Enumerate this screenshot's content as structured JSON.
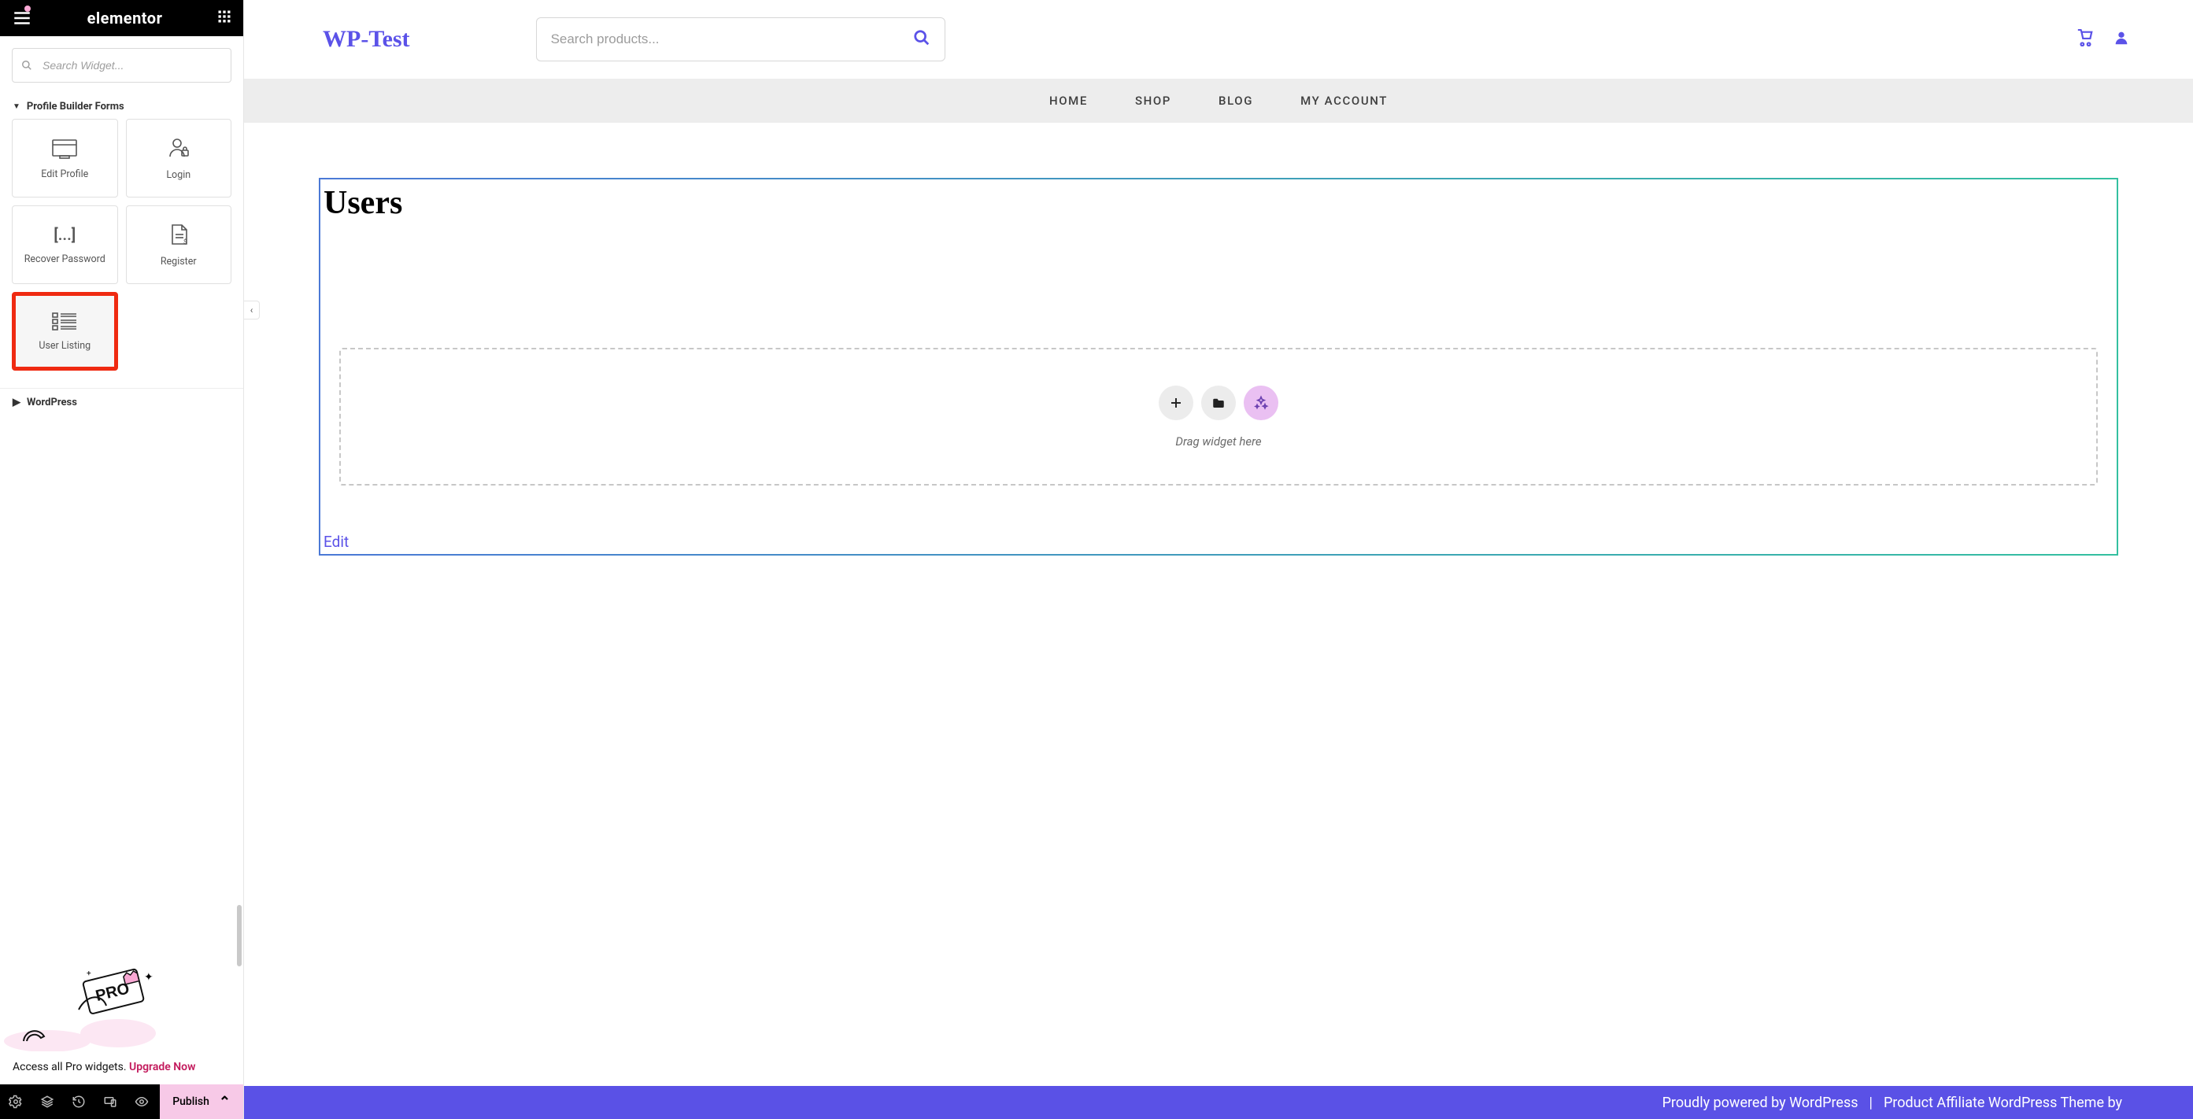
{
  "panel": {
    "brand_label": "elementor",
    "search_placeholder": "Search Widget...",
    "section1_title": "Profile Builder Forms",
    "widgets": [
      {
        "label": "Edit Profile"
      },
      {
        "label": "Login"
      },
      {
        "label": "Recover Password"
      },
      {
        "label": "Register"
      },
      {
        "label": "User Listing"
      }
    ],
    "section2_title": "WordPress",
    "promo_text": "Access all Pro widgets. ",
    "promo_cta": "Upgrade Now",
    "publish_label": "Publish"
  },
  "preview": {
    "site_title": "WP-Test",
    "product_search_placeholder": "Search products...",
    "nav": [
      "HOME",
      "SHOP",
      "BLOG",
      "MY ACCOUNT"
    ],
    "section_heading": "Users",
    "dropzone_hint": "Drag widget here",
    "edit_label": "Edit"
  },
  "footer": {
    "left": "Proudly powered by WordPress",
    "sep": "|",
    "right": "Product Affiliate WordPress Theme by"
  }
}
